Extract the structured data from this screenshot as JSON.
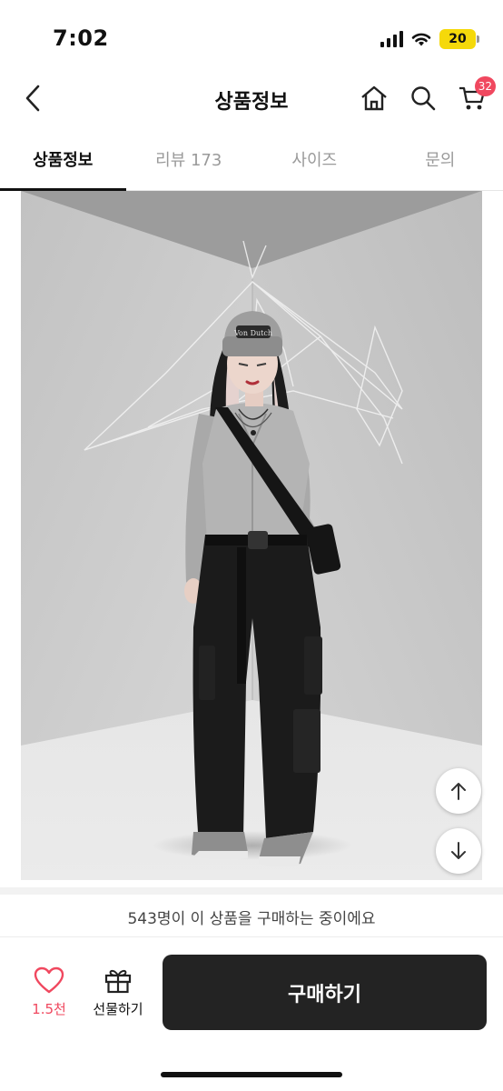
{
  "status_bar": {
    "time": "7:02",
    "battery": "20"
  },
  "header": {
    "title": "상품정보",
    "cart_count": "32"
  },
  "tabs": [
    {
      "label": "상품정보",
      "active": true
    },
    {
      "label": "리뷰 173",
      "active": false
    },
    {
      "label": "사이즈",
      "active": false
    },
    {
      "label": "문의",
      "active": false
    }
  ],
  "purchase_info": "543명이 이 상품을 구매하는 중이에요",
  "bottom_bar": {
    "like_count": "1.5천",
    "gift_label": "선물하기",
    "buy_label": "구매하기"
  },
  "product_image": {
    "hat_text": "Von Dutch"
  },
  "colors": {
    "accent": "#f0485f",
    "buy_button": "#232323"
  }
}
